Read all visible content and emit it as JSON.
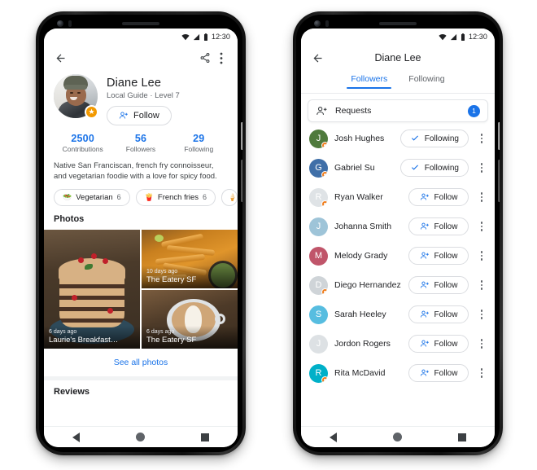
{
  "phones": {
    "left": {
      "status": {
        "time": "12:30",
        "icons": [
          "wifi-icon",
          "signal-icon",
          "battery-icon"
        ]
      },
      "appbar": {
        "back": "back-arrow-icon",
        "share": "share-icon",
        "more": "overflow-menu-icon"
      },
      "profile": {
        "name": "Diane Lee",
        "subtitle": "Local Guide · Level 7",
        "badge": "★",
        "follow_label": "Follow",
        "stats": [
          {
            "value": "2500",
            "caption": "Contributions"
          },
          {
            "value": "56",
            "caption": "Followers"
          },
          {
            "value": "29",
            "caption": "Following"
          }
        ],
        "bio": "Native San Franciscan, french fry connoisseur, and vegetarian foodie with a love for spicy food.",
        "chips": [
          {
            "emoji": "🥗",
            "label": "Vegetarian",
            "count": "6"
          },
          {
            "emoji": "🍟",
            "label": "French fries",
            "count": "6"
          },
          {
            "emoji": "🍦",
            "label": "",
            "count": ""
          }
        ]
      },
      "photos": {
        "section_title": "Photos",
        "items": [
          {
            "date": "6 days ago",
            "title": "Laurie's Breakfast…"
          },
          {
            "date": "10 days ago",
            "title": "The Eatery SF"
          },
          {
            "date": "6 days ago",
            "title": "The Eatery SF"
          }
        ],
        "see_all": "See all photos"
      },
      "reviews": {
        "section_title": "Reviews"
      },
      "navbar": {
        "back": "nav-back-icon",
        "home": "nav-home-icon",
        "recents": "nav-recents-icon"
      }
    },
    "right": {
      "status": {
        "time": "12:30",
        "icons": [
          "wifi-icon",
          "signal-icon",
          "battery-icon"
        ]
      },
      "appbar": {
        "back": "back-arrow-icon",
        "title": "Diane Lee"
      },
      "tabs": [
        {
          "label": "Followers",
          "active": true
        },
        {
          "label": "Following",
          "active": false
        }
      ],
      "requests": {
        "label": "Requests",
        "count": "1"
      },
      "followers": [
        {
          "name": "Josh Hughes",
          "action": "Following",
          "state": "following",
          "avatar_color": "#4f7a3c",
          "initial": "J",
          "guide_badge": true
        },
        {
          "name": "Gabriel Su",
          "action": "Following",
          "state": "following",
          "avatar_color": "#3f6fa8",
          "initial": "G",
          "guide_badge": true
        },
        {
          "name": "Ryan Walker",
          "action": "Follow",
          "state": "follow",
          "avatar_color": "#dfe3e6",
          "initial": "R",
          "guide_badge": true
        },
        {
          "name": "Johanna Smith",
          "action": "Follow",
          "state": "follow",
          "avatar_color": "#9ec4d8",
          "initial": "J",
          "guide_badge": false
        },
        {
          "name": "Melody Grady",
          "action": "Follow",
          "state": "follow",
          "avatar_color": "#c0556a",
          "initial": "M",
          "guide_badge": false
        },
        {
          "name": "Diego Hernandez",
          "action": "Follow",
          "state": "follow",
          "avatar_color": "#cfd4d8",
          "initial": "D",
          "guide_badge": true
        },
        {
          "name": "Sarah Heeley",
          "action": "Follow",
          "state": "follow",
          "avatar_color": "#57bde0",
          "initial": "S",
          "guide_badge": false
        },
        {
          "name": "Jordon Rogers",
          "action": "Follow",
          "state": "follow",
          "avatar_color": "#dde1e4",
          "initial": "J",
          "guide_badge": false
        },
        {
          "name": "Rita McDavid",
          "action": "Follow",
          "state": "follow",
          "avatar_color": "#00b0c8",
          "initial": "R",
          "guide_badge": true
        }
      ],
      "navbar": {
        "back": "nav-back-icon",
        "home": "nav-home-icon",
        "recents": "nav-recents-icon"
      }
    }
  },
  "colors": {
    "accent": "#1a73e8",
    "badge_orange": "#f29900",
    "text_primary": "#202124",
    "text_secondary": "#5f6368",
    "divider": "#e8eaed"
  }
}
